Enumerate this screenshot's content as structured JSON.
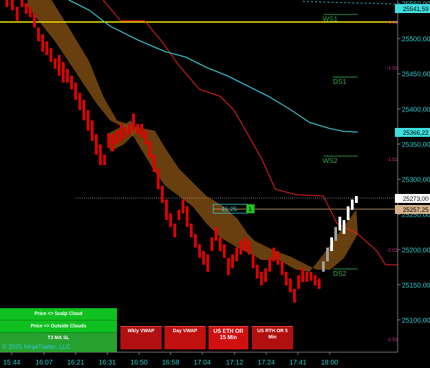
{
  "y_axis": {
    "ticks": [
      "25550,00",
      "25500,00",
      "25450,00",
      "25400,00",
      "25350,00",
      "25300,00",
      "25250,00",
      "25200,00",
      "25150,00",
      "25100,00"
    ],
    "tick_values": [
      25550,
      25500,
      25450,
      25400,
      25350,
      25300,
      25250,
      25200,
      25150,
      25100
    ],
    "color": "#2fd0d0"
  },
  "x_axis": {
    "ticks": [
      "15:44",
      "16:07",
      "16:21",
      "16:31",
      "16:50",
      "16:58",
      "17:04",
      "17:12",
      "17:24",
      "17:41",
      "18:00"
    ]
  },
  "price_tags": {
    "top": "25541,59",
    "middle": "25366,22",
    "last": "25273,00",
    "vwap": "25257,25"
  },
  "levels": {
    "ws1": "WS1",
    "ds1": "DS1",
    "ws2": "WS2",
    "ds2": "DS2"
  },
  "pct_labels": [
    "-1.01",
    "-1.51",
    "-2.01",
    "-2.51"
  ],
  "position_box": {
    "value": "15,25",
    "qty": "1"
  },
  "panel": {
    "scalp_cloud": "Price <> Scalp Cloud",
    "outside_clouds": "Price <> Outside Clouds",
    "t3_ma_sl": "T3 MA SL",
    "copyright": "© 2025 NinjaTrader, LLC"
  },
  "vwap_buttons": {
    "wkly": "Wkly VWAP",
    "day": "Day VWAP",
    "us_eth": "US ETH OR 15 Min",
    "us_rth": "US RTH OR 5 Min"
  },
  "colors": {
    "background": "#000000",
    "axis_text": "#2fd0d0",
    "yellow_line": "#e6d200",
    "red_line": "#e02020",
    "cyan_line": "#40e0e0",
    "cloud": "#7a4a10",
    "candle_red": "#e00000",
    "candle_white": "#ffffff",
    "button_green": "#10c020",
    "button_red": "#c01010"
  }
}
